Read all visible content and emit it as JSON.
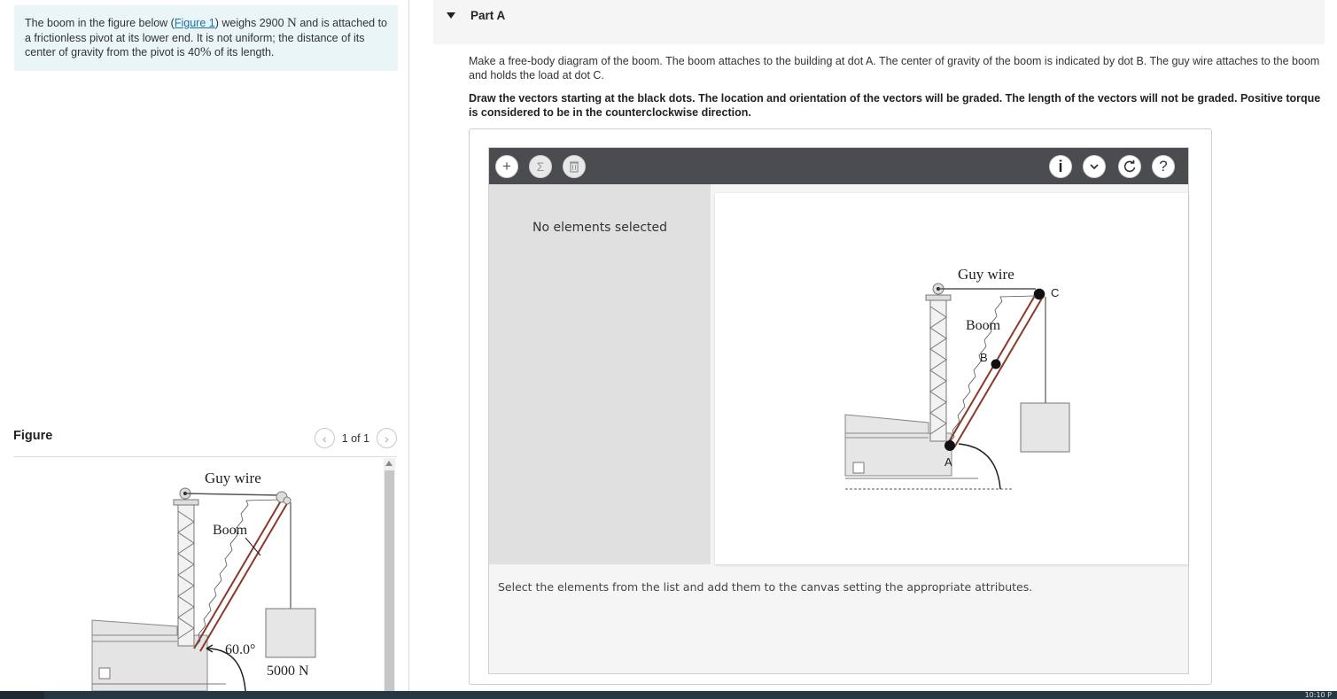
{
  "problem": {
    "text_1": "The boom in the figure below (",
    "figure_link": "Figure 1",
    "text_2": ") weighs 2900 ",
    "unit_n": "N",
    "text_3": " and is attached to a frictionless pivot at its lower end. It is not uniform; the distance of its center of gravity from the pivot is 40",
    "percent": "%",
    "text_4": " of its length."
  },
  "figure_panel": {
    "title": "Figure",
    "pager_text": "1 of 1",
    "prev_icon": "chevron-left-icon",
    "next_icon": "chevron-right-icon",
    "labels": {
      "guy_wire": "Guy wire",
      "boom": "Boom",
      "angle": "60.0°",
      "load": "5000 N"
    }
  },
  "part_a": {
    "title": "Part A",
    "instruction_1": "Make a free-body diagram of the boom. The boom attaches to the building at dot A. The center of gravity of the boom is indicated by dot B. The guy wire attaches to the boom and holds the load at dot C.",
    "instruction_2": "Draw the vectors starting at the black dots. The location and orientation of the vectors will be graded. The length of the vectors will not be graded. Positive torque is considered to be in the counterclockwise direction."
  },
  "widget": {
    "toolbar_left": [
      {
        "icon": "plus-icon",
        "glyph": "+"
      },
      {
        "icon": "sigma-icon",
        "glyph": "Σ"
      },
      {
        "icon": "trash-icon",
        "glyph": "🗑"
      }
    ],
    "toolbar_right": [
      {
        "icon": "info-icon",
        "glyph": "i"
      },
      {
        "icon": "chevron-down-icon",
        "glyph": "⌄"
      },
      {
        "icon": "reset-icon",
        "glyph": "↻"
      },
      {
        "icon": "help-icon",
        "glyph": "?"
      }
    ],
    "panel_text": "No elements selected",
    "canvas_labels": {
      "guy_wire": "Guy wire",
      "boom": "Boom",
      "dot_a": "A",
      "dot_b": "B",
      "dot_c": "C"
    },
    "status_text": "Select the elements from the list and add them to the canvas setting the appropriate attributes."
  },
  "taskbar": {
    "clock": "10:10 P"
  },
  "colors": {
    "problem_bg": "#e9f5f7",
    "link": "#1a6fa8",
    "toolbar_bg": "#4b4c50",
    "panel_bg": "#e0e0e0",
    "boom_brown": "#8b3a2a"
  }
}
